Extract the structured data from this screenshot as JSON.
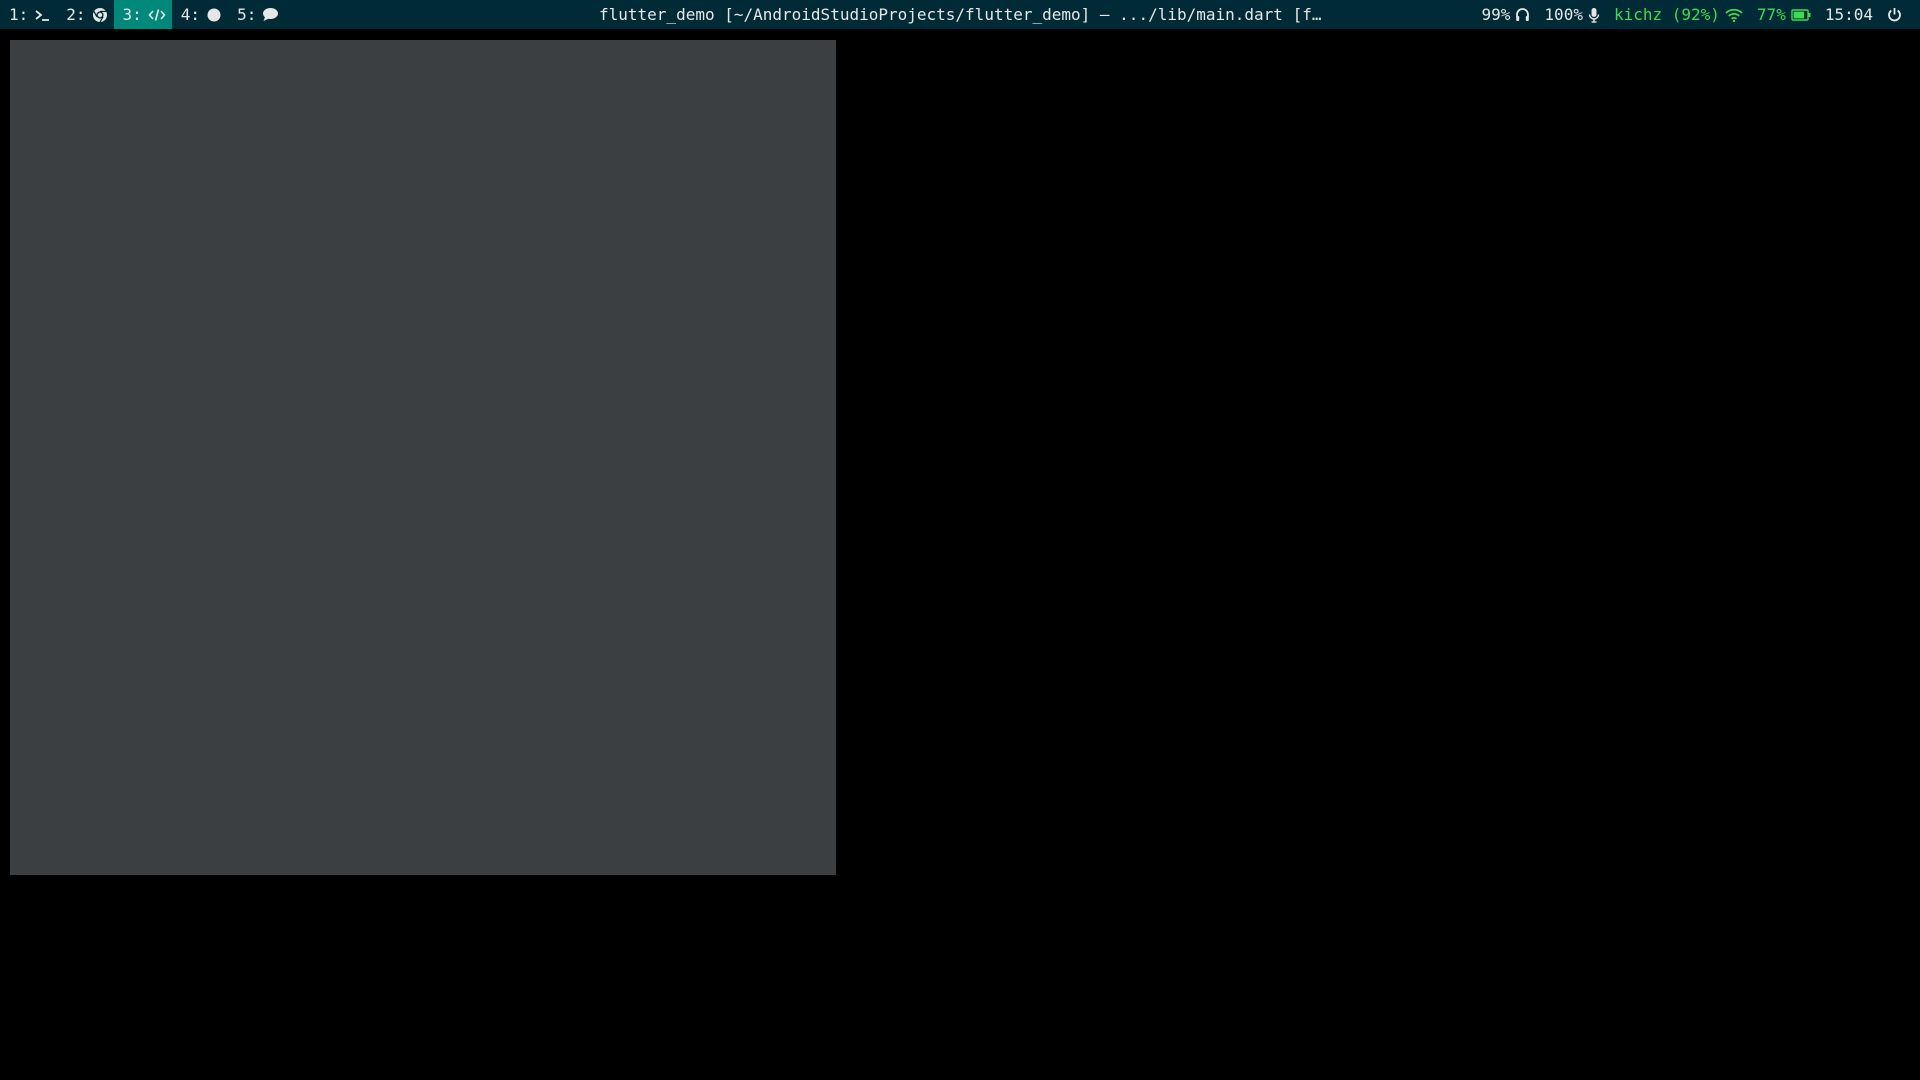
{
  "colors": {
    "bar_background": "#002b36",
    "active_workspace": "#00897b",
    "text": "#e6e6e6",
    "accent_green": "#3ddc52",
    "desktop_background": "#000000",
    "window_panel": "#3b3f42"
  },
  "workspaces": [
    {
      "label": "1:",
      "icon": "terminal-icon"
    },
    {
      "label": "2:",
      "icon": "chrome-icon"
    },
    {
      "label": "3:",
      "icon": "code-icon",
      "active": true
    },
    {
      "label": "4:",
      "icon": "circle-icon"
    },
    {
      "label": "5:",
      "icon": "chat-bubble-icon"
    }
  ],
  "window_title": "flutter_demo [~/AndroidStudioProjects/flutter_demo] – .../lib/main.dart [flutte…",
  "status": {
    "headphones_volume": "99%",
    "headphones_icon": "headphones-icon",
    "mic_volume": "100%",
    "mic_icon": "microphone-icon",
    "wifi": "kichz (92%)",
    "wifi_icon": "wifi-icon",
    "battery": "77%",
    "battery_icon": "battery-icon",
    "clock": "15:04",
    "power_icon": "power-icon"
  }
}
